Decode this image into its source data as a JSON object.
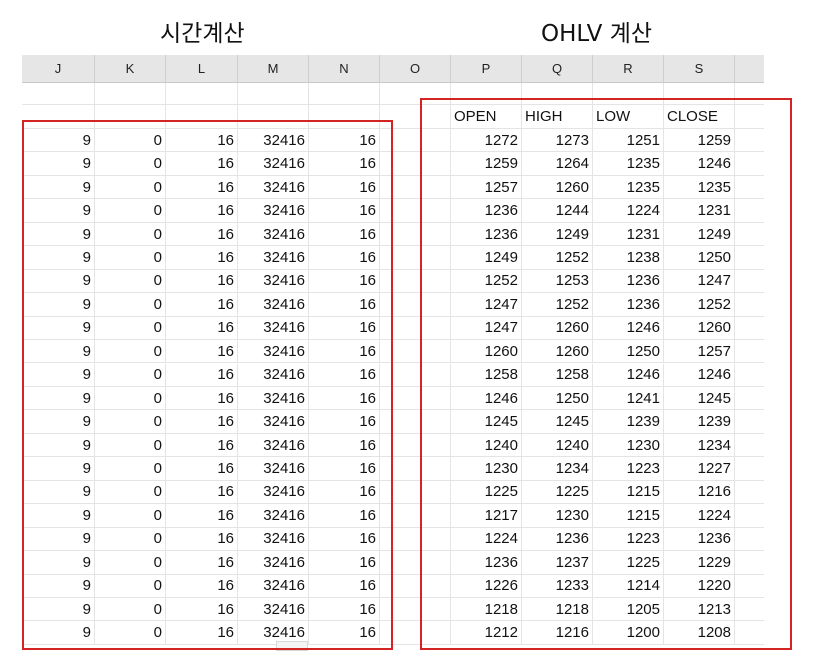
{
  "captions": {
    "left": "시간계산",
    "right": "OHLV 계산"
  },
  "sheet": {
    "columns": [
      "J",
      "K",
      "L",
      "M",
      "N",
      "O",
      "P",
      "Q",
      "R",
      "S"
    ],
    "ohlc_headers": [
      "OPEN",
      "HIGH",
      "LOW",
      "CLOSE"
    ],
    "time_rows": [
      [
        "9",
        "0",
        "16",
        "32416",
        "16"
      ],
      [
        "9",
        "0",
        "16",
        "32416",
        "16"
      ],
      [
        "9",
        "0",
        "16",
        "32416",
        "16"
      ],
      [
        "9",
        "0",
        "16",
        "32416",
        "16"
      ],
      [
        "9",
        "0",
        "16",
        "32416",
        "16"
      ],
      [
        "9",
        "0",
        "16",
        "32416",
        "16"
      ],
      [
        "9",
        "0",
        "16",
        "32416",
        "16"
      ],
      [
        "9",
        "0",
        "16",
        "32416",
        "16"
      ],
      [
        "9",
        "0",
        "16",
        "32416",
        "16"
      ],
      [
        "9",
        "0",
        "16",
        "32416",
        "16"
      ],
      [
        "9",
        "0",
        "16",
        "32416",
        "16"
      ],
      [
        "9",
        "0",
        "16",
        "32416",
        "16"
      ],
      [
        "9",
        "0",
        "16",
        "32416",
        "16"
      ],
      [
        "9",
        "0",
        "16",
        "32416",
        "16"
      ],
      [
        "9",
        "0",
        "16",
        "32416",
        "16"
      ],
      [
        "9",
        "0",
        "16",
        "32416",
        "16"
      ],
      [
        "9",
        "0",
        "16",
        "32416",
        "16"
      ],
      [
        "9",
        "0",
        "16",
        "32416",
        "16"
      ],
      [
        "9",
        "0",
        "16",
        "32416",
        "16"
      ],
      [
        "9",
        "0",
        "16",
        "32416",
        "16"
      ],
      [
        "9",
        "0",
        "16",
        "32416",
        "16"
      ],
      [
        "9",
        "0",
        "16",
        "32416",
        "16"
      ]
    ],
    "ohlc_rows": [
      [
        "1272",
        "1273",
        "1251",
        "1259"
      ],
      [
        "1259",
        "1264",
        "1235",
        "1246"
      ],
      [
        "1257",
        "1260",
        "1235",
        "1235"
      ],
      [
        "1236",
        "1244",
        "1224",
        "1231"
      ],
      [
        "1236",
        "1249",
        "1231",
        "1249"
      ],
      [
        "1249",
        "1252",
        "1238",
        "1250"
      ],
      [
        "1252",
        "1253",
        "1236",
        "1247"
      ],
      [
        "1247",
        "1252",
        "1236",
        "1252"
      ],
      [
        "1247",
        "1260",
        "1246",
        "1260"
      ],
      [
        "1260",
        "1260",
        "1250",
        "1257"
      ],
      [
        "1258",
        "1258",
        "1246",
        "1246"
      ],
      [
        "1246",
        "1250",
        "1241",
        "1245"
      ],
      [
        "1245",
        "1245",
        "1239",
        "1239"
      ],
      [
        "1240",
        "1240",
        "1230",
        "1234"
      ],
      [
        "1230",
        "1234",
        "1223",
        "1227"
      ],
      [
        "1225",
        "1225",
        "1215",
        "1216"
      ],
      [
        "1217",
        "1230",
        "1215",
        "1224"
      ],
      [
        "1224",
        "1236",
        "1223",
        "1236"
      ],
      [
        "1236",
        "1237",
        "1225",
        "1229"
      ],
      [
        "1226",
        "1233",
        "1214",
        "1220"
      ],
      [
        "1218",
        "1218",
        "1205",
        "1213"
      ],
      [
        "1212",
        "1216",
        "1200",
        "1208"
      ]
    ]
  },
  "highlight_color": "#d42323"
}
